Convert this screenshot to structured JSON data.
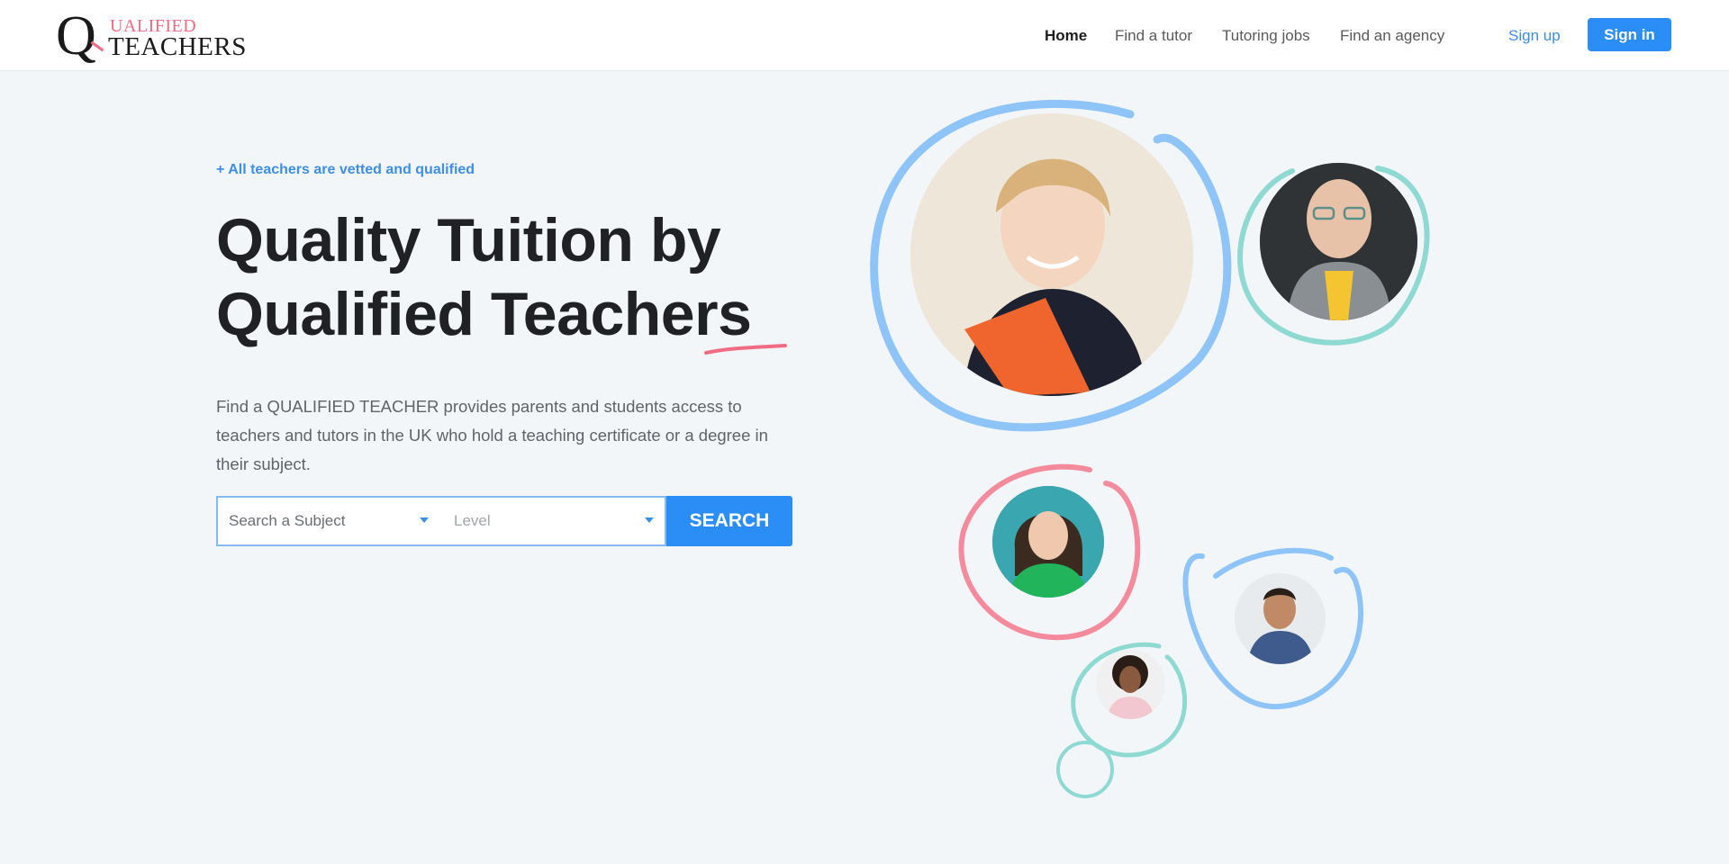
{
  "logo": {
    "initial": "Q",
    "top_text": "UALIFIED",
    "bottom_text": "TEACHERS"
  },
  "nav": {
    "home": "Home",
    "find_tutor": "Find a tutor",
    "tutoring_jobs": "Tutoring jobs",
    "find_agency": "Find an agency",
    "sign_up": "Sign up",
    "sign_in": "Sign in"
  },
  "hero": {
    "tagline": "+ All teachers are vetted and qualified",
    "headline": "Quality Tuition by Qualified Teachers",
    "description": "Find a QUALIFIED TEACHER provides parents and students access to teachers and tutors in the UK who hold a teaching certificate or a degree in their subject."
  },
  "search": {
    "subject_placeholder": "Search a Subject",
    "level_placeholder": "Level",
    "button": "SEARCH"
  },
  "colors": {
    "accent": "#2b8ef6",
    "pink": "#f06b84",
    "teal": "#8fd9d3",
    "light_blue": "#8ec4f7",
    "background": "#f3f6f9"
  }
}
